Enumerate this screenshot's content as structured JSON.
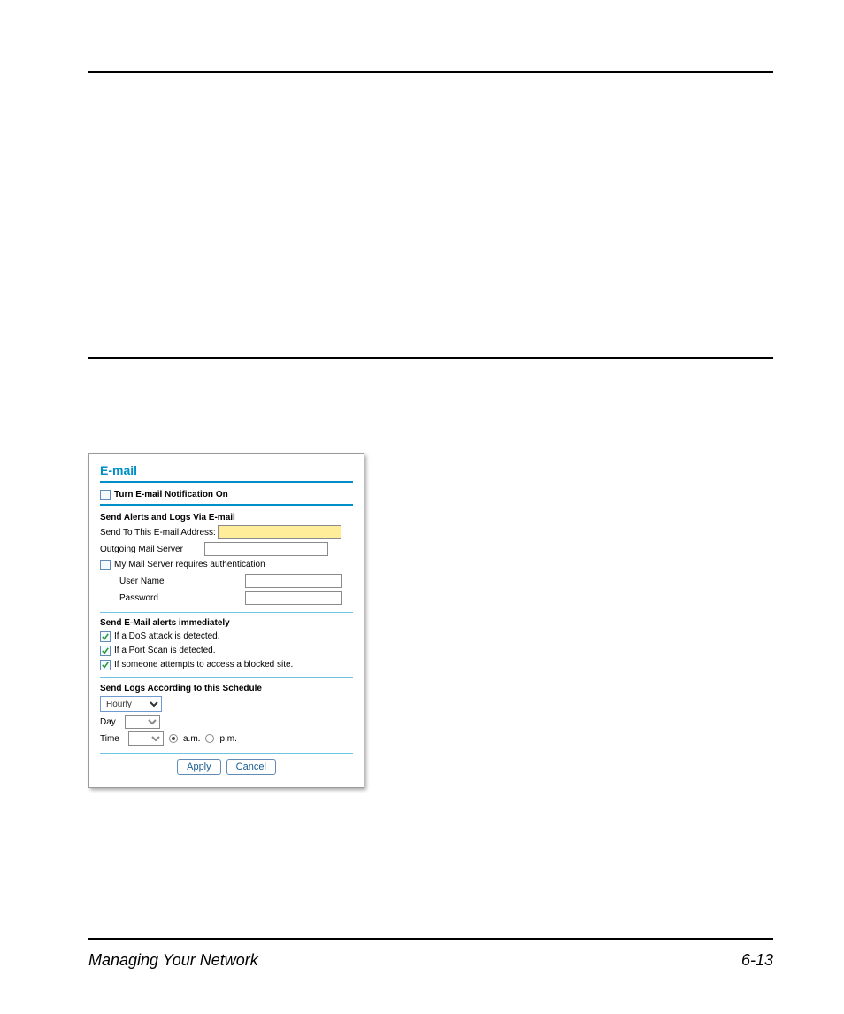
{
  "footer": {
    "left": "Managing Your Network",
    "right": "6-13"
  },
  "panel": {
    "title": "E-mail",
    "s1": {
      "turn_on_label": "Turn E-mail Notification On",
      "turn_on_checked": false
    },
    "s2": {
      "heading": "Send Alerts and Logs Via E-mail",
      "addr_label": "Send To This E-mail Address:",
      "addr_value": "",
      "srv_label": "Outgoing Mail Server",
      "srv_value": "",
      "auth_checked": false,
      "auth_label": "My Mail Server requires authentication",
      "user_label": "User Name",
      "user_value": "",
      "pass_label": "Password",
      "pass_value": ""
    },
    "s3": {
      "heading": "Send E-Mail alerts immediately",
      "alerts": [
        {
          "checked": true,
          "label": "If a DoS attack is detected."
        },
        {
          "checked": true,
          "label": "If a Port Scan is detected."
        },
        {
          "checked": true,
          "label": "If someone attempts to access a blocked site."
        }
      ]
    },
    "s4": {
      "heading": "Send Logs According to this Schedule",
      "schedule_value": "Hourly",
      "day_label": "Day",
      "day_value": "",
      "time_label": "Time",
      "time_value": "",
      "am_label": "a.m.",
      "pm_label": "p.m.",
      "ampm": "am"
    },
    "buttons": {
      "apply": "Apply",
      "cancel": "Cancel"
    }
  }
}
